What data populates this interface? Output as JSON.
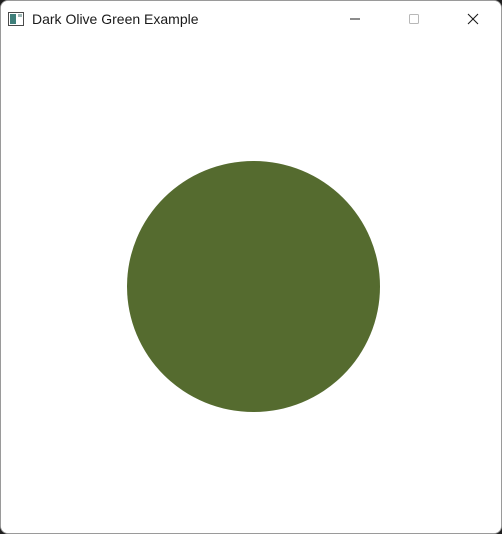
{
  "window": {
    "title": "Dark Olive Green Example",
    "icon": "app-window-icon",
    "controls": {
      "minimize_icon": "minimize-icon",
      "maximize_icon": "maximize-icon",
      "close_icon": "close-icon"
    }
  },
  "canvas": {
    "background": "#ffffff",
    "shape": "circle",
    "fill": "#556b2f"
  }
}
